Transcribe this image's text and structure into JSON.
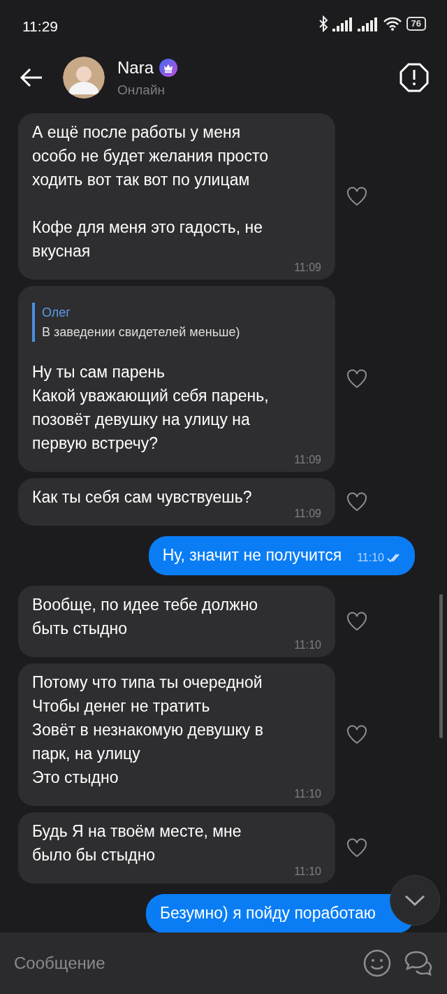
{
  "status_bar": {
    "time": "11:29",
    "battery": "76"
  },
  "header": {
    "name": "Nara",
    "status": "Онлайн"
  },
  "messages": [
    {
      "kind": "incoming",
      "text": "А ещё после работы у меня\nособо не будет желания просто\nходить вот так вот по улицам\n\nКофе для меня это гадость, не\nвкусная",
      "time": "11:09"
    },
    {
      "kind": "incoming",
      "reply": {
        "author": "Олег",
        "text": "В заведении свидетелей меньше)"
      },
      "text": "Ну ты сам парень\nКакой уважающий себя парень,\nпозовёт девушку на улицу на\nпервую встречу?",
      "time": "11:09"
    },
    {
      "kind": "incoming",
      "text": "Как ты себя сам чувствуешь?",
      "time": "11:09"
    },
    {
      "kind": "outgoing",
      "text": "Ну, значит не получится",
      "time": "11:10",
      "read": true
    },
    {
      "kind": "incoming",
      "text": "Вообще, по идее тебе должно\nбыть стыдно",
      "time": "11:10"
    },
    {
      "kind": "incoming",
      "text": "Потому что типа ты очередной\nЧтобы денег не тратить\nЗовёт в незнакомую девушку в\nпарк, на улицу\nЭто стыдно",
      "time": "11:10"
    },
    {
      "kind": "incoming",
      "text": "Будь Я на твоём месте, мне\nбыло бы стыдно",
      "time": "11:10"
    },
    {
      "kind": "outgoing",
      "text": "Безумно) я пойду поработаю"
    }
  ],
  "composer": {
    "placeholder": "Сообщение"
  }
}
